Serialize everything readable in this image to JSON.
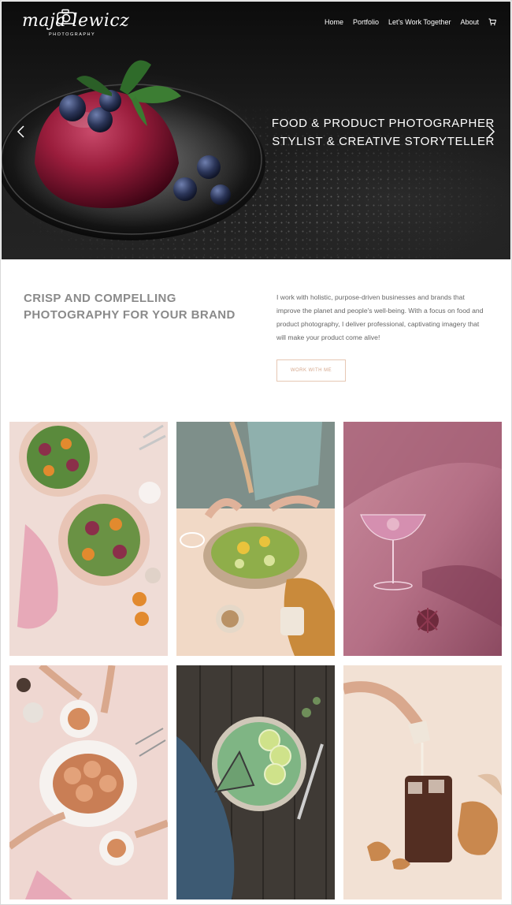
{
  "brand": {
    "logo_text": "maja lewicz",
    "logo_sub": "PHOTOGRAPHY"
  },
  "nav": {
    "items": [
      {
        "label": "Home"
      },
      {
        "label": "Portfolio"
      },
      {
        "label": "Let's Work Together"
      },
      {
        "label": "About"
      }
    ],
    "cart_icon": "cart-icon"
  },
  "hero": {
    "line1": "FOOD & PRODUCT PHOTOGRAPHER",
    "line2": "STYLIST & CREATIVE STORYTELLER",
    "prev_icon": "chevron-left-icon",
    "next_icon": "chevron-right-icon"
  },
  "intro": {
    "heading_line1": "CRISP AND COMPELLING",
    "heading_line2": "PHOTOGRAPHY FOR YOUR BRAND",
    "body": "I work with holistic, purpose-driven businesses and brands that improve the planet and people's well-being.  With a focus on food and product photography,  I deliver professional, captivating imagery that will make your product come alive!",
    "cta_label": "WORK WITH ME"
  },
  "colors": {
    "accent": "#d5a58a",
    "heading": "#8a8a8a"
  }
}
